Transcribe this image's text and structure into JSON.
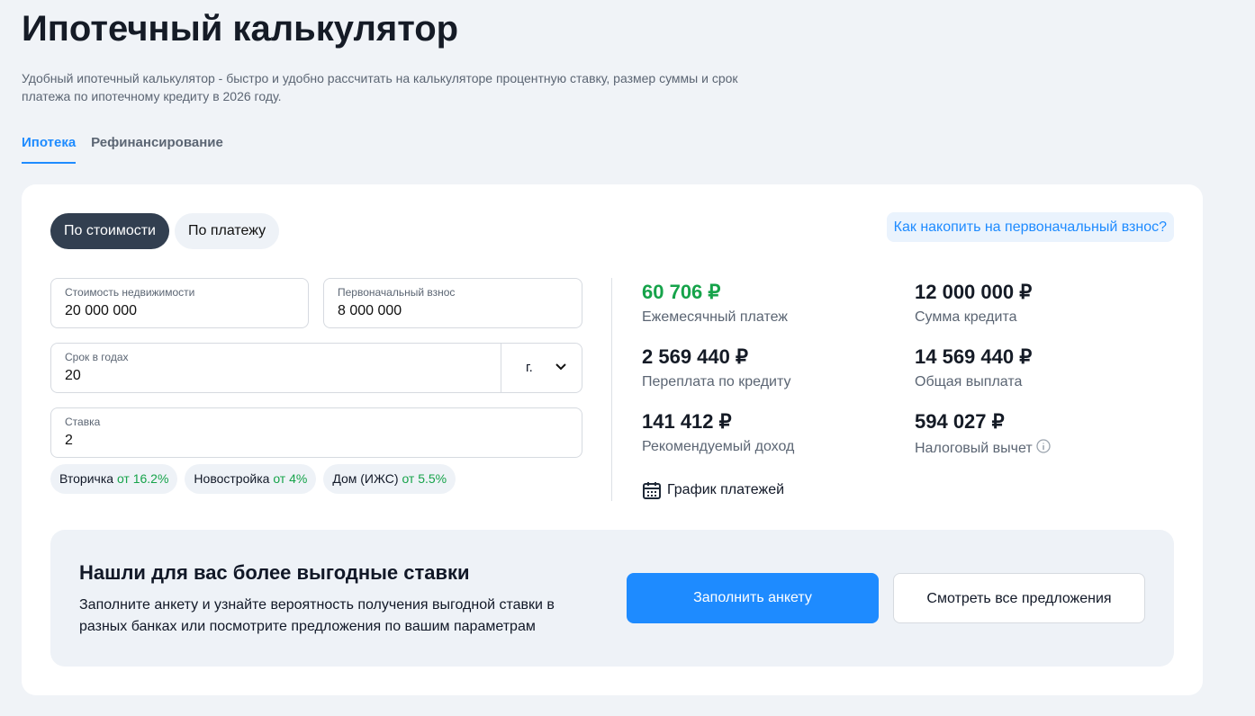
{
  "title": "Ипотечный калькулятор",
  "description": "Удобный ипотечный калькулятор - быстро и удобно рассчитать на калькуляторе процентную ставку, размер суммы и срок платежа по ипотечному кредиту в 2026 году.",
  "tabs": [
    "Ипотека",
    "Рефинансирование"
  ],
  "modes": [
    "По стоимости",
    "По платежу"
  ],
  "savings_link": "Как накопить на первоначальный взнос?",
  "fields": {
    "price": {
      "label": "Стоимость недвижимости",
      "value": "20 000 000"
    },
    "down": {
      "label": "Первоначальный взнос",
      "value": "8 000 000"
    },
    "term": {
      "label": "Срок в годах",
      "value": "20",
      "unit": "г."
    },
    "rate": {
      "label": "Ставка",
      "value": "2"
    }
  },
  "chips": [
    {
      "name": "Вторичка",
      "rate": "от 16.2%"
    },
    {
      "name": "Новостройка",
      "rate": "от 4%"
    },
    {
      "name": "Дом (ИЖС)",
      "rate": "от 5.5%"
    }
  ],
  "results": [
    {
      "value": "60 706 ₽",
      "label": "Ежемесячный платеж"
    },
    {
      "value": "12 000 000 ₽",
      "label": "Сумма кредита"
    },
    {
      "value": "2 569 440 ₽",
      "label": "Переплата по кредиту"
    },
    {
      "value": "14 569 440 ₽",
      "label": "Общая выплата"
    },
    {
      "value": "141 412 ₽",
      "label": "Рекомендуемый доход"
    },
    {
      "value": "594 027 ₽",
      "label": "Налоговый вычет"
    }
  ],
  "schedule": "График платежей",
  "promo": {
    "title": "Нашли для вас более выгодные ставки",
    "text": "Заполните анкету и узнайте вероятность получения выгодной ставки в разных банках или посмотрите предложения по вашим параметрам",
    "primary": "Заполнить анкету",
    "secondary": "Смотреть все предложения"
  },
  "colors": {
    "accent": "#1e8bff",
    "green": "#16a34a",
    "dark": "#323f50"
  }
}
